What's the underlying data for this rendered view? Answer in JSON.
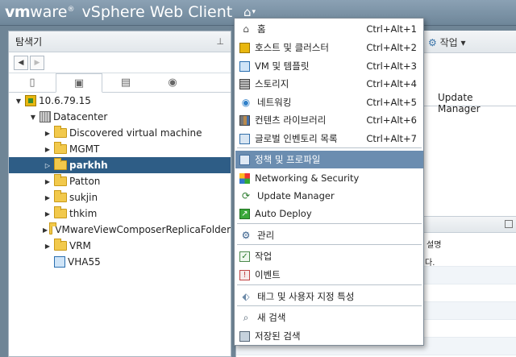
{
  "app": {
    "brand_vm": "vm",
    "brand_ware": "ware",
    "brand_reg": "®",
    "brand_title": "vSphere Web Client",
    "home_icon": "⌂",
    "home_caret": "▾"
  },
  "navigator": {
    "title": "탐색기",
    "pin_icon": "pin-icon",
    "back_icon": "◀",
    "forward_icon": "▶",
    "tabs": [
      {
        "icon": "hosts-clusters-icon"
      },
      {
        "icon": "vms-templates-icon",
        "active": true
      },
      {
        "icon": "storage-icon"
      },
      {
        "icon": "networking-icon"
      }
    ],
    "tree": [
      {
        "label": "10.6.79.15",
        "level": 0,
        "expanded": true,
        "type": "vcenter"
      },
      {
        "label": "Datacenter",
        "level": 1,
        "expanded": true,
        "type": "datacenter"
      },
      {
        "label": "Discovered virtual machine",
        "level": 2,
        "type": "folder"
      },
      {
        "label": "MGMT",
        "level": 2,
        "type": "folder"
      },
      {
        "label": "parkhh",
        "level": 2,
        "type": "folder",
        "selected": true
      },
      {
        "label": "Patton",
        "level": 2,
        "type": "folder"
      },
      {
        "label": "sukjin",
        "level": 2,
        "type": "folder"
      },
      {
        "label": "thkim",
        "level": 2,
        "type": "folder"
      },
      {
        "label": "VMwareViewComposerReplicaFolder",
        "level": 2,
        "type": "folder"
      },
      {
        "label": "VRM",
        "level": 2,
        "type": "folder"
      },
      {
        "label": "VHA55",
        "level": 2,
        "type": "vapp"
      }
    ]
  },
  "content": {
    "actions_label": "작업",
    "actions_icon": "gear-icon",
    "update_manager_tab": "Update Manager",
    "description_col": "설명",
    "description_text": "다."
  },
  "home_menu": {
    "items": [
      {
        "icon": "home-icon",
        "label": "홈",
        "shortcut": "Ctrl+Alt+1"
      },
      {
        "icon": "hosts-clusters-icon",
        "label": "호스트 및 클러스터",
        "shortcut": "Ctrl+Alt+2"
      },
      {
        "icon": "vms-templates-icon",
        "label": "VM 및 템플릿",
        "shortcut": "Ctrl+Alt+3"
      },
      {
        "icon": "storage-icon",
        "label": "스토리지",
        "shortcut": "Ctrl+Alt+4"
      },
      {
        "icon": "networking-icon",
        "label": "네트워킹",
        "shortcut": "Ctrl+Alt+5"
      },
      {
        "icon": "content-library-icon",
        "label": "컨텐츠 라이브러리",
        "shortcut": "Ctrl+Alt+6"
      },
      {
        "icon": "global-inventory-icon",
        "label": "글로벌 인벤토리 목록",
        "shortcut": "Ctrl+Alt+7"
      },
      {
        "icon": "policies-profiles-icon",
        "label": "정책 및 프로파일",
        "shortcut": "",
        "highlighted": true
      },
      {
        "icon": "networking-security-icon",
        "label": "Networking & Security",
        "shortcut": ""
      },
      {
        "icon": "update-manager-icon",
        "label": "Update Manager",
        "shortcut": ""
      },
      {
        "icon": "auto-deploy-icon",
        "label": "Auto Deploy",
        "shortcut": ""
      },
      {
        "icon": "administration-icon",
        "label": "관리",
        "shortcut": ""
      },
      {
        "icon": "tasks-icon",
        "label": "작업",
        "shortcut": ""
      },
      {
        "icon": "events-icon",
        "label": "이벤트",
        "shortcut": ""
      },
      {
        "icon": "tag-icon",
        "label": "태그 및 사용자 지정 특성",
        "shortcut": ""
      },
      {
        "icon": "search-icon",
        "label": "새 검색",
        "shortcut": ""
      },
      {
        "icon": "saved-search-icon",
        "label": "저장된 검색",
        "shortcut": ""
      }
    ]
  }
}
